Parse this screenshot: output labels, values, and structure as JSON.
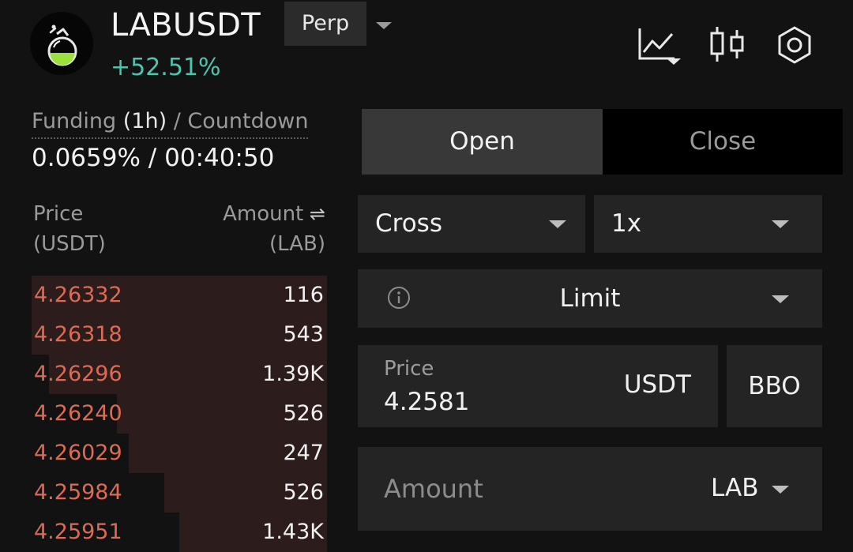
{
  "header": {
    "pair": "LABUSDT",
    "contract_type": "Perp",
    "change_pct": "+52.51%",
    "change_color": "#4ec4ad",
    "logo_icon": "flask-icon",
    "icons": [
      "chart-type-icon",
      "candlestick-icon",
      "settings-hexagon-icon"
    ]
  },
  "funding": {
    "label_prefix": "Funding",
    "label_interval": "(1h)",
    "label_suffix": "/ Countdown",
    "value": "0.0659% / 00:40:50"
  },
  "orderbook": {
    "price_header": "Price",
    "price_unit": "(USDT)",
    "amount_header": "Amount",
    "amount_unit": "(LAB)",
    "ask_color": "#dc6b56",
    "asks": [
      {
        "price": "4.26332",
        "amount": "116",
        "depth": 1.0
      },
      {
        "price": "4.26318",
        "amount": "543",
        "depth": 1.0
      },
      {
        "price": "4.26296",
        "amount": "1.39K",
        "depth": 0.94
      },
      {
        "price": "4.26240",
        "amount": "526",
        "depth": 0.71
      },
      {
        "price": "4.26029",
        "amount": "247",
        "depth": 0.67
      },
      {
        "price": "4.25984",
        "amount": "526",
        "depth": 0.55
      },
      {
        "price": "4.25951",
        "amount": "1.43K",
        "depth": 0.5
      }
    ]
  },
  "form": {
    "tabs": {
      "open": "Open",
      "close": "Close",
      "active": "open"
    },
    "margin_mode": "Cross",
    "leverage": "1x",
    "order_type": "Limit",
    "price": {
      "label": "Price",
      "value": "4.2581",
      "unit": "USDT"
    },
    "bbo_label": "BBO",
    "amount": {
      "placeholder": "Amount",
      "unit": "LAB"
    }
  }
}
